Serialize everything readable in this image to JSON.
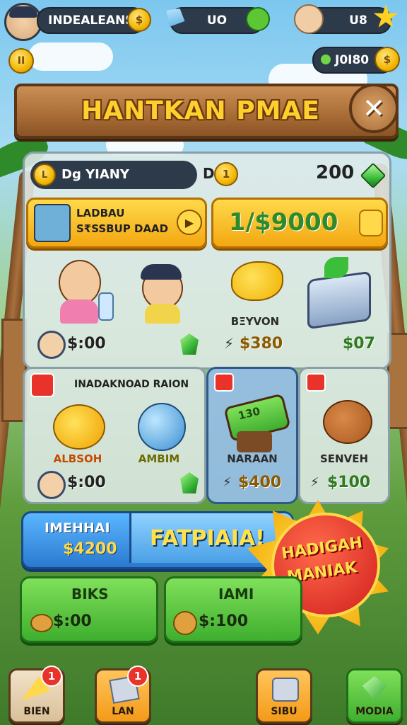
{
  "top_bar": {
    "player_name": "INDEALEANS",
    "gem_count": "UO",
    "friend_count": "U8",
    "wallet": "J0I80"
  },
  "title": "HANTKAN PMAE",
  "main_panel": {
    "header_label": "Dg YIANY",
    "header_coin_letter": "D",
    "header_value": "200",
    "offer_card": {
      "line1": "LADBAU",
      "line2": "S₹SSBUP DAAD"
    },
    "price_banner": "1/$9000",
    "items": [
      {
        "label": "",
        "price": "$:00"
      },
      {
        "label": "BΞYVON",
        "price": "$380"
      },
      {
        "label": "",
        "price": "$07"
      }
    ]
  },
  "section2": {
    "title": "INADAKNOAD RAION",
    "items": [
      {
        "label": "ALBSOH",
        "price": "$:00"
      },
      {
        "label": "AMBIM",
        "price": ""
      }
    ]
  },
  "section3": {
    "label": "NARAAN",
    "price": "$400",
    "sign": "130"
  },
  "section4": {
    "label": "SENVEH",
    "price": "$100"
  },
  "promo": {
    "line1": "IMEHHAI",
    "line2": "$4200",
    "button": "FATPIAIA!"
  },
  "starburst": {
    "line1": "HADIGAH",
    "line2": "MANIAK"
  },
  "green_buttons": [
    {
      "label": "BIKS",
      "price": "$:00"
    },
    {
      "label": "IAMI",
      "price": "$:100"
    }
  ],
  "nav": [
    {
      "label": "BIEN",
      "badge": "1"
    },
    {
      "label": "LAN",
      "badge": "1"
    },
    {
      "label": "SIBU",
      "badge": ""
    },
    {
      "label": "MODIA",
      "badge": ""
    }
  ],
  "colors": {
    "accent": "#f3a712",
    "brand": "#ffcf2e",
    "danger": "#e8322a",
    "success": "#3fae2e"
  }
}
